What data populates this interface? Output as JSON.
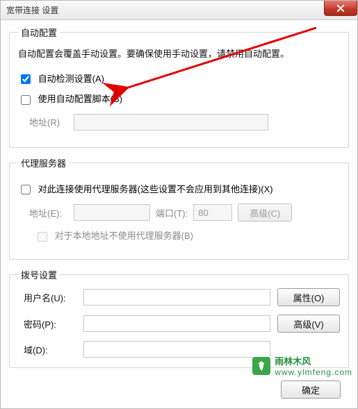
{
  "window": {
    "title": "宽带连接 设置"
  },
  "auto": {
    "legend": "自动配置",
    "note": "自动配置会覆盖手动设置。要确保使用手动设置，请禁用自动配置。",
    "detect_label": "自动检测设置(A)",
    "detect_checked": true,
    "script_label": "使用自动配置脚本(S)",
    "script_checked": false,
    "address_label": "地址(R)",
    "address_value": ""
  },
  "proxy": {
    "legend": "代理服务器",
    "use_label": "对此连接使用代理服务器(这些设置不会应用到其他连接)(X)",
    "use_checked": false,
    "address_label": "地址(E):",
    "address_value": "",
    "port_label": "端口(T):",
    "port_value": "80",
    "advanced_label": "高级(C)",
    "bypass_label": "对于本地地址不使用代理服务器(B)",
    "bypass_checked": false
  },
  "dial": {
    "legend": "拨号设置",
    "user_label": "用户名(U):",
    "user_value": "",
    "pass_label": "密码(P):",
    "pass_value": "",
    "domain_label": "域(D):",
    "domain_value": "",
    "properties_label": "属性(O)",
    "advanced_label": "高级(V)"
  },
  "footer": {
    "ok_label": "确定"
  },
  "watermark": {
    "brand": "雨林木风",
    "url": "www.ylmfeng.com"
  }
}
